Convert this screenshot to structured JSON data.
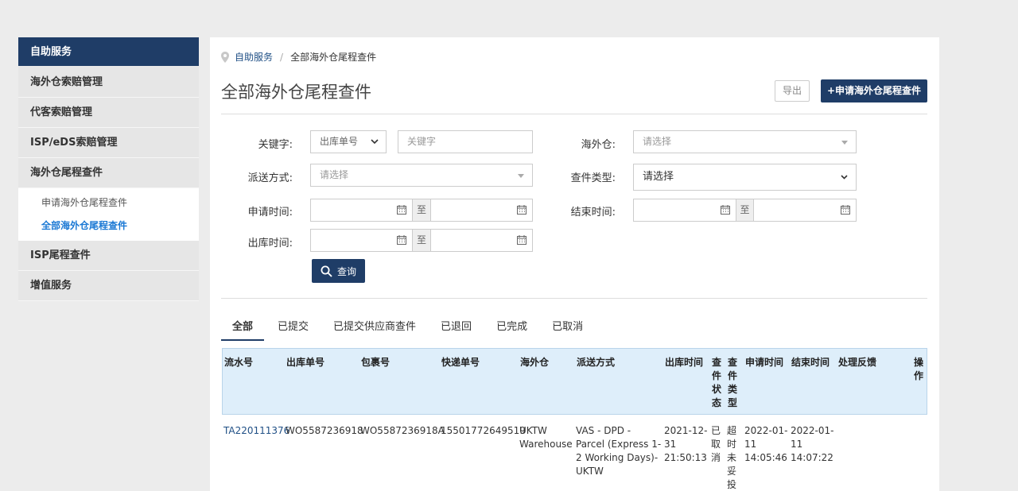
{
  "sidebar": {
    "header": "自助服务",
    "items": [
      "海外仓索赔管理",
      "代客索赔管理",
      "ISP/eDS索赔管理",
      "海外仓尾程查件"
    ],
    "sub_items": [
      "申请海外仓尾程查件",
      "全部海外仓尾程查件"
    ],
    "items_after": [
      "ISP尾程查件",
      "增值服务"
    ]
  },
  "breadcrumb": {
    "root": "自助服务",
    "sep": "/",
    "current": "全部海外仓尾程查件"
  },
  "page": {
    "title": "全部海外仓尾程查件",
    "export_label": "导出",
    "apply_label": "+申请海外仓尾程查件"
  },
  "filters": {
    "keyword_label": "关键字:",
    "keyword_type": "出库单号",
    "keyword_placeholder": "关键字",
    "warehouse_label": "海外仓:",
    "warehouse_placeholder": "请选择",
    "delivery_label": "派送方式:",
    "delivery_placeholder": "请选择",
    "inquiry_type_label": "查件类型:",
    "inquiry_type_value": "请选择",
    "apply_time_label": "申请时间:",
    "end_time_label": "结束时间:",
    "outbound_time_label": "出库时间:",
    "to": "至",
    "query_label": "查询"
  },
  "tabs": [
    "全部",
    "已提交",
    "已提交供应商查件",
    "已退回",
    "已完成",
    "已取消"
  ],
  "table": {
    "headers": {
      "serial": "流水号",
      "outbound": "出库单号",
      "package": "包裹号",
      "tracking": "快递单号",
      "warehouse": "海外仓",
      "delivery": "派送方式",
      "out_time": "出库时间",
      "status": "查件状态",
      "type": "查件类型",
      "apply_time": "申请时间",
      "end_time": "结束时间",
      "feedback": "处理反馈",
      "action": "操作"
    },
    "row": {
      "serial": "TA220111376",
      "outbound": "WO5587236918",
      "package": "WO5587236918A",
      "tracking": "15501772649519",
      "warehouse": "UKTW Warehouse",
      "delivery": "VAS - DPD - Parcel (Express 1-2 Working Days)-UKTW",
      "out_time": "2021-12-31 21:50:13",
      "status": "已取消",
      "type": "超时未妥投",
      "apply_time": "2022-01-11 14:05:46",
      "end_time": "2022-01-11 14:07:22"
    }
  },
  "colors": {
    "primary": "#1f3d67",
    "link": "#1a78d4",
    "table_header_bg": "#deeefa"
  }
}
